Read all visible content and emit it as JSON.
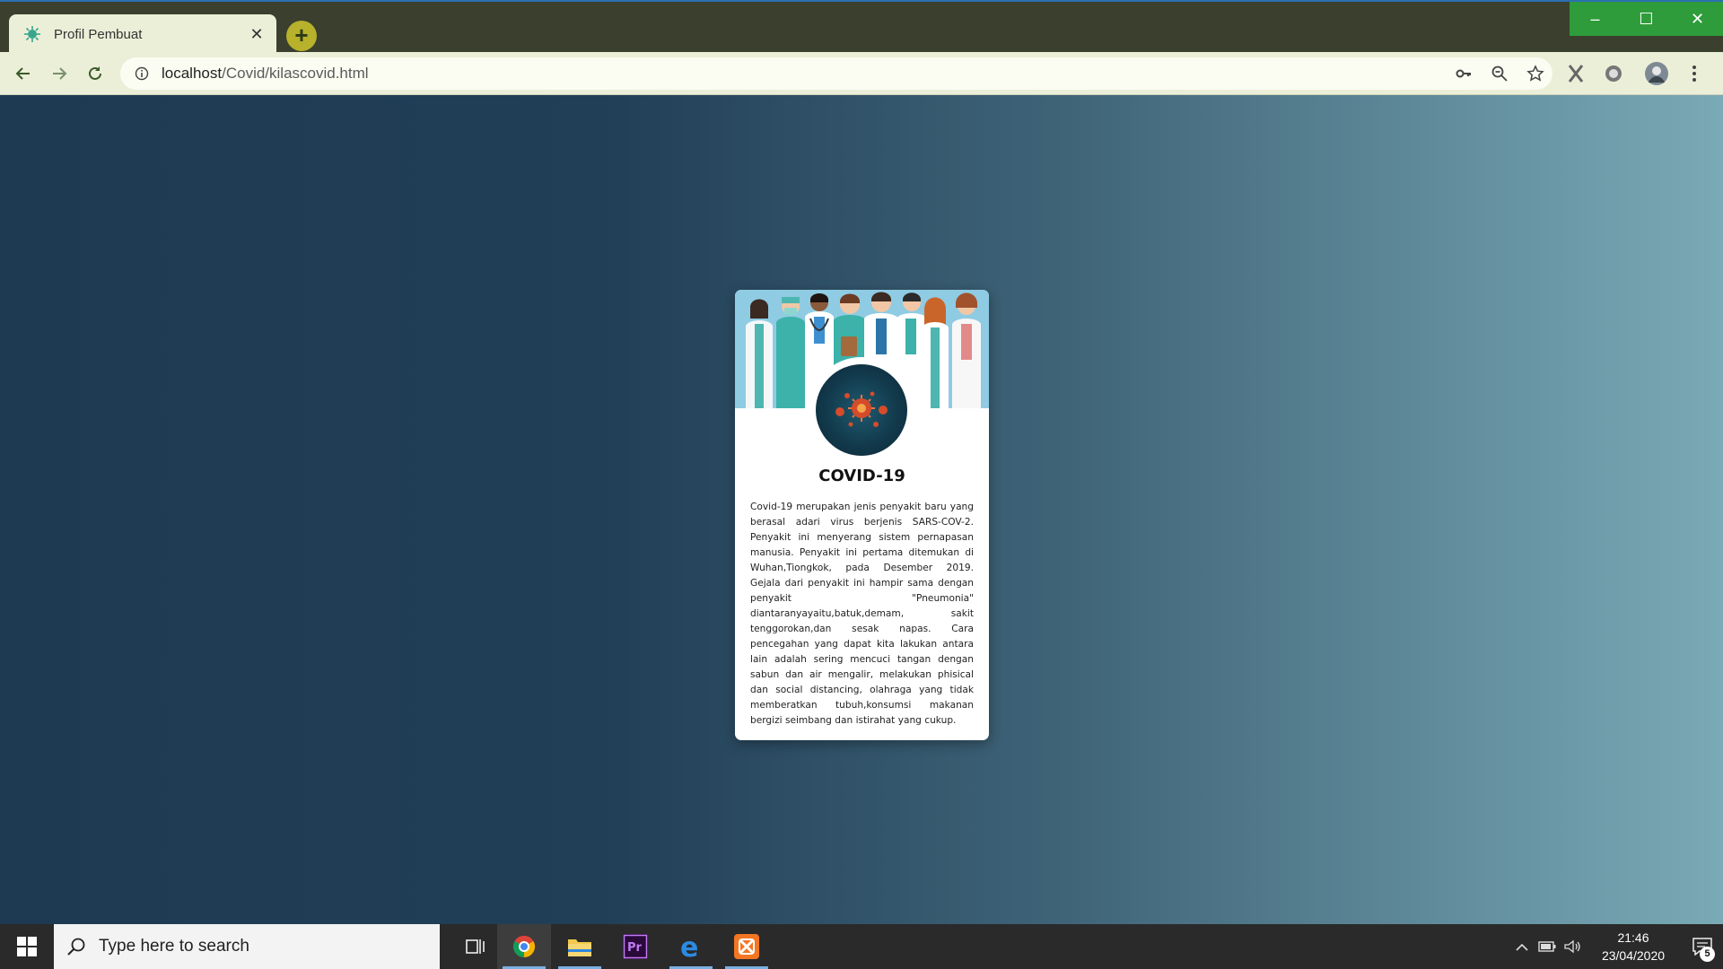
{
  "browser": {
    "tab_title": "Profil Pembuat",
    "tab_close": "✕",
    "new_tab": "+",
    "url_host": "localhost",
    "url_path": "/Covid/kilascovid.html",
    "window_controls": [
      "–",
      "☐",
      "✕"
    ]
  },
  "card": {
    "title": "COVID-19",
    "description": "Covid-19 merupakan jenis penyakit baru yang berasal adari virus berjenis SARS-COV-2. Penyakit ini menyerang sistem pernapasan manusia. Penyakit ini pertama ditemukan di Wuhan,Tiongkok, pada Desember 2019. Gejala dari penyakit ini hampir sama dengan penyakit \"Pneumonia\" diantaranyayaitu,batuk,demam, sakit tenggorokan,dan sesak napas. Cara pencegahan yang dapat kita lakukan antara lain adalah sering mencuci tangan dengan sabun dan air mengalir, melakukan phisical dan social distancing, olahraga yang tidak memberatkan tubuh,konsumsi makanan bergizi seimbang dan istirahat yang cukup."
  },
  "taskbar": {
    "search_placeholder": "Type here to search",
    "time": "21:46",
    "date": "23/04/2020",
    "notification_count": "5"
  },
  "colors": {
    "accent_green": "#2e9c3a",
    "tab_bg": "#ecefd8",
    "page_gradient_start": "#1e3a52",
    "page_gradient_end": "#7aaab6"
  }
}
